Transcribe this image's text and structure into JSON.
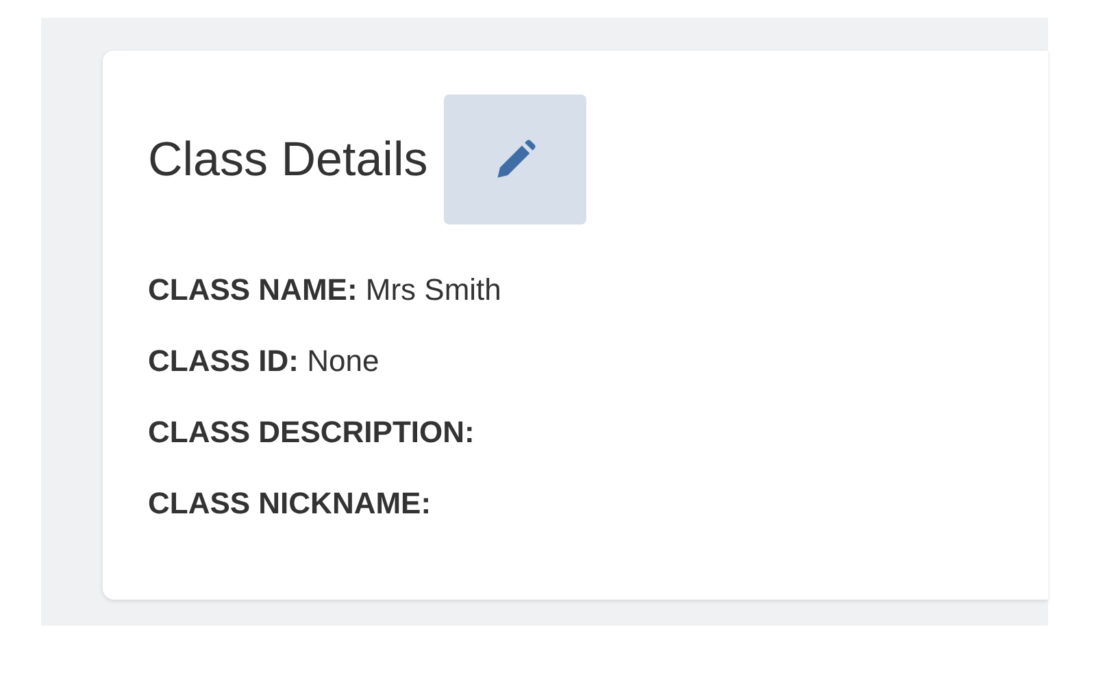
{
  "card": {
    "title": "Class Details",
    "fields": [
      {
        "label": "CLASS NAME:",
        "value": "Mrs Smith"
      },
      {
        "label": "CLASS ID:",
        "value": "None"
      },
      {
        "label": "CLASS DESCRIPTION:"
      },
      {
        "label": "CLASS NICKNAME:"
      }
    ]
  }
}
